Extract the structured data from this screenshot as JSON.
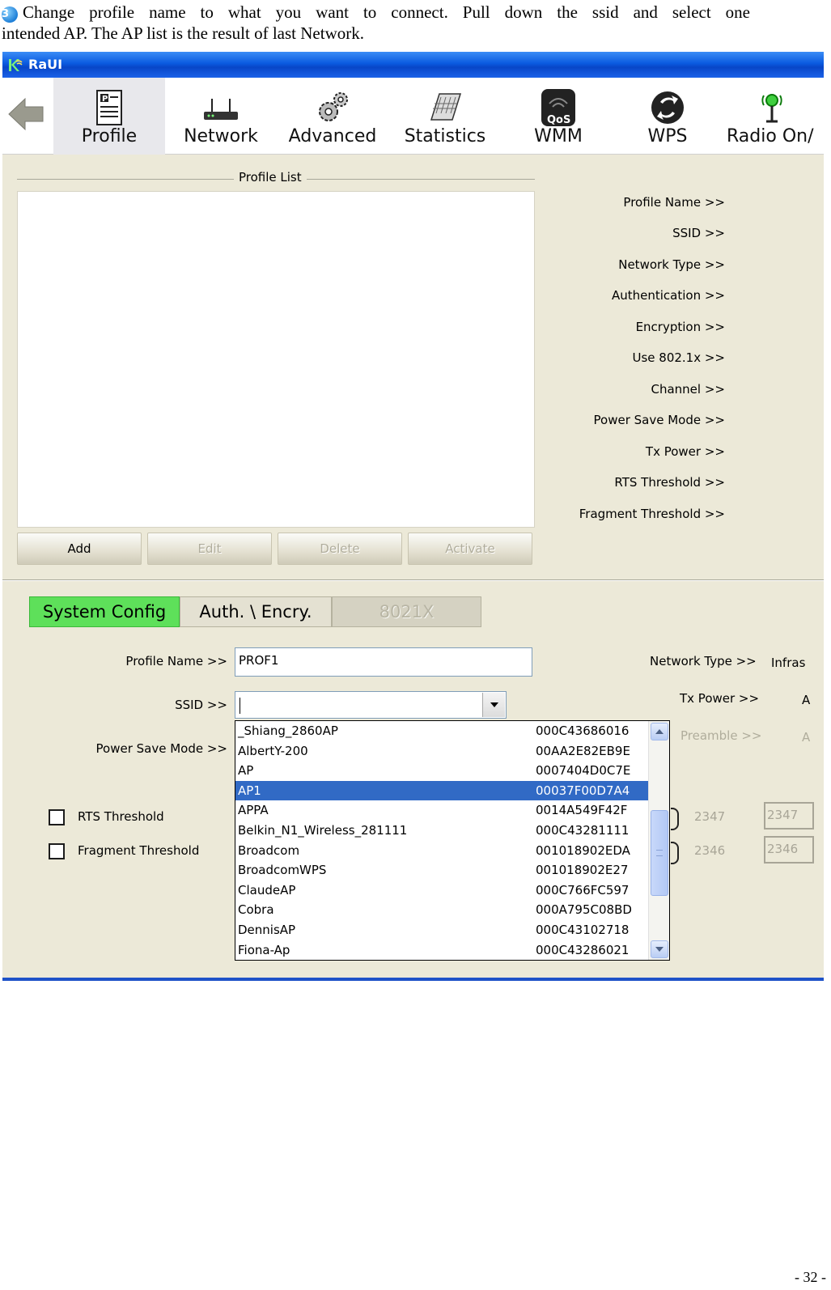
{
  "doc": {
    "step_number": "3",
    "line1": "Change profile name to what you want to connect. Pull down the ssid and select one",
    "line2": "intended AP. The AP list is the result of last Network.",
    "page_number": "- 32 -"
  },
  "window": {
    "title": "RaUI"
  },
  "toolbar": {
    "items": [
      {
        "label": "Profile",
        "icon": "profile-icon"
      },
      {
        "label": "Network",
        "icon": "network-icon"
      },
      {
        "label": "Advanced",
        "icon": "advanced-icon"
      },
      {
        "label": "Statistics",
        "icon": "statistics-icon"
      },
      {
        "label": "WMM",
        "icon": "wmm-icon"
      },
      {
        "label": "WPS",
        "icon": "wps-icon"
      },
      {
        "label": "Radio On/",
        "icon": "radio-icon"
      }
    ],
    "wmm_badge": "QoS"
  },
  "profile_list": {
    "title": "Profile List",
    "details": [
      "Profile Name >>",
      "SSID >>",
      "Network Type >>",
      "Authentication >>",
      "Encryption >>",
      "Use 802.1x >>",
      "Channel >>",
      "Power Save Mode >>",
      "Tx Power >>",
      "RTS Threshold >>",
      "Fragment Threshold >>"
    ],
    "buttons": {
      "add": "Add",
      "edit": "Edit",
      "delete": "Delete",
      "activate": "Activate"
    }
  },
  "tabs": {
    "system_config": "System Config",
    "auth_encry": "Auth. \\ Encry.",
    "x8021": "8021X"
  },
  "config": {
    "profile_name_label": "Profile Name >>",
    "profile_name_value": "PROF1",
    "ssid_label": "SSID >>",
    "ssid_value": "",
    "power_save_label": "Power Save Mode >>",
    "network_type_label": "Network Type >>",
    "network_type_value": "Infras",
    "tx_power_label": "Tx Power >>",
    "tx_power_value": "A",
    "preamble_label": "Preamble >>",
    "preamble_value": "A",
    "rts_label": "RTS Threshold",
    "rts_value": "2347",
    "rts_box": "2347",
    "frag_label": "Fragment Threshold",
    "frag_value": "2346",
    "frag_box": "2346"
  },
  "ssid_dropdown": {
    "selected_index": 3,
    "items": [
      {
        "name": "_Shiang_2860AP",
        "mac": "000C43686016"
      },
      {
        "name": "AlbertY-200",
        "mac": "00AA2E82EB9E"
      },
      {
        "name": "AP",
        "mac": "0007404D0C7E"
      },
      {
        "name": "AP1",
        "mac": "00037F00D7A4"
      },
      {
        "name": "APPA",
        "mac": "0014A549F42F"
      },
      {
        "name": "Belkin_N1_Wireless_281111",
        "mac": "000C43281111"
      },
      {
        "name": "Broadcom",
        "mac": "001018902EDA"
      },
      {
        "name": "BroadcomWPS",
        "mac": "001018902E27"
      },
      {
        "name": "ClaudeAP",
        "mac": "000C766FC597"
      },
      {
        "name": "Cobra",
        "mac": "000A795C08BD"
      },
      {
        "name": "DennisAP",
        "mac": "000C43102718"
      },
      {
        "name": "Fiona-Ap",
        "mac": "000C43286021"
      }
    ]
  },
  "colors": {
    "active_tab": "#5ee05a",
    "selection": "#316ac5",
    "titlebar": "#0a5ae0"
  }
}
